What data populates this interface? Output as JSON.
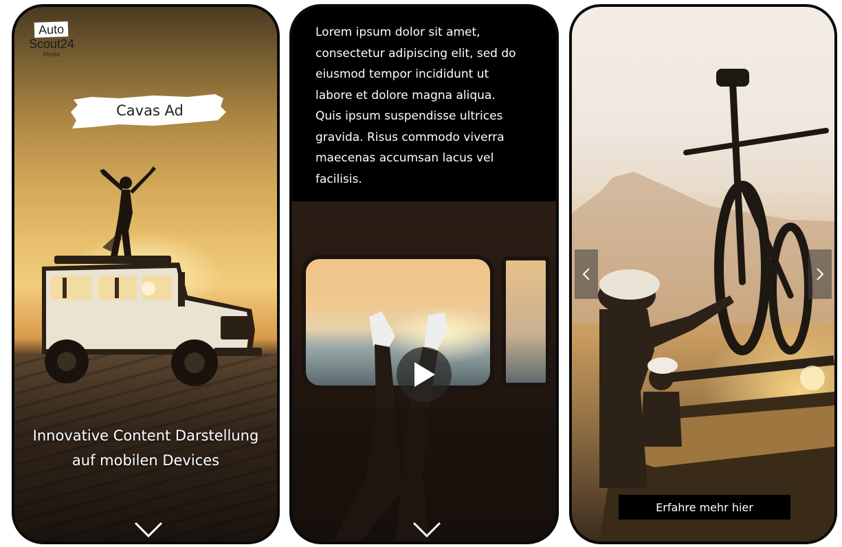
{
  "slides": [
    {
      "logo": {
        "line1": "Auto",
        "line2": "Scout24",
        "line3": "Media"
      },
      "banner_label": "Cavas Ad",
      "headline_line1": "Innovative Content Darstellung",
      "headline_line2": "auf mobilen Devices",
      "scroll_icon": "chevron-down-icon"
    },
    {
      "body_lines": [
        "Lorem ipsum dolor sit amet,",
        "consectetur adipiscing elit, sed do",
        "eiusmod tempor incididunt ut",
        "labore et dolore magna aliqua.",
        "Quis ipsum suspendisse ultrices",
        "gravida. Risus commodo viverra",
        "maecenas accumsan lacus vel",
        "facilisis."
      ],
      "play_icon": "play-icon",
      "scroll_icon": "chevron-down-icon"
    },
    {
      "prev_icon": "chevron-left-icon",
      "next_icon": "chevron-right-icon",
      "cta_label": "Erfahre mehr hier"
    }
  ],
  "colors": {
    "frame": "#0a0a0a",
    "text_light": "#ffffff",
    "cta_background": "#000000",
    "sunset_accent": "#f2cd7c"
  }
}
